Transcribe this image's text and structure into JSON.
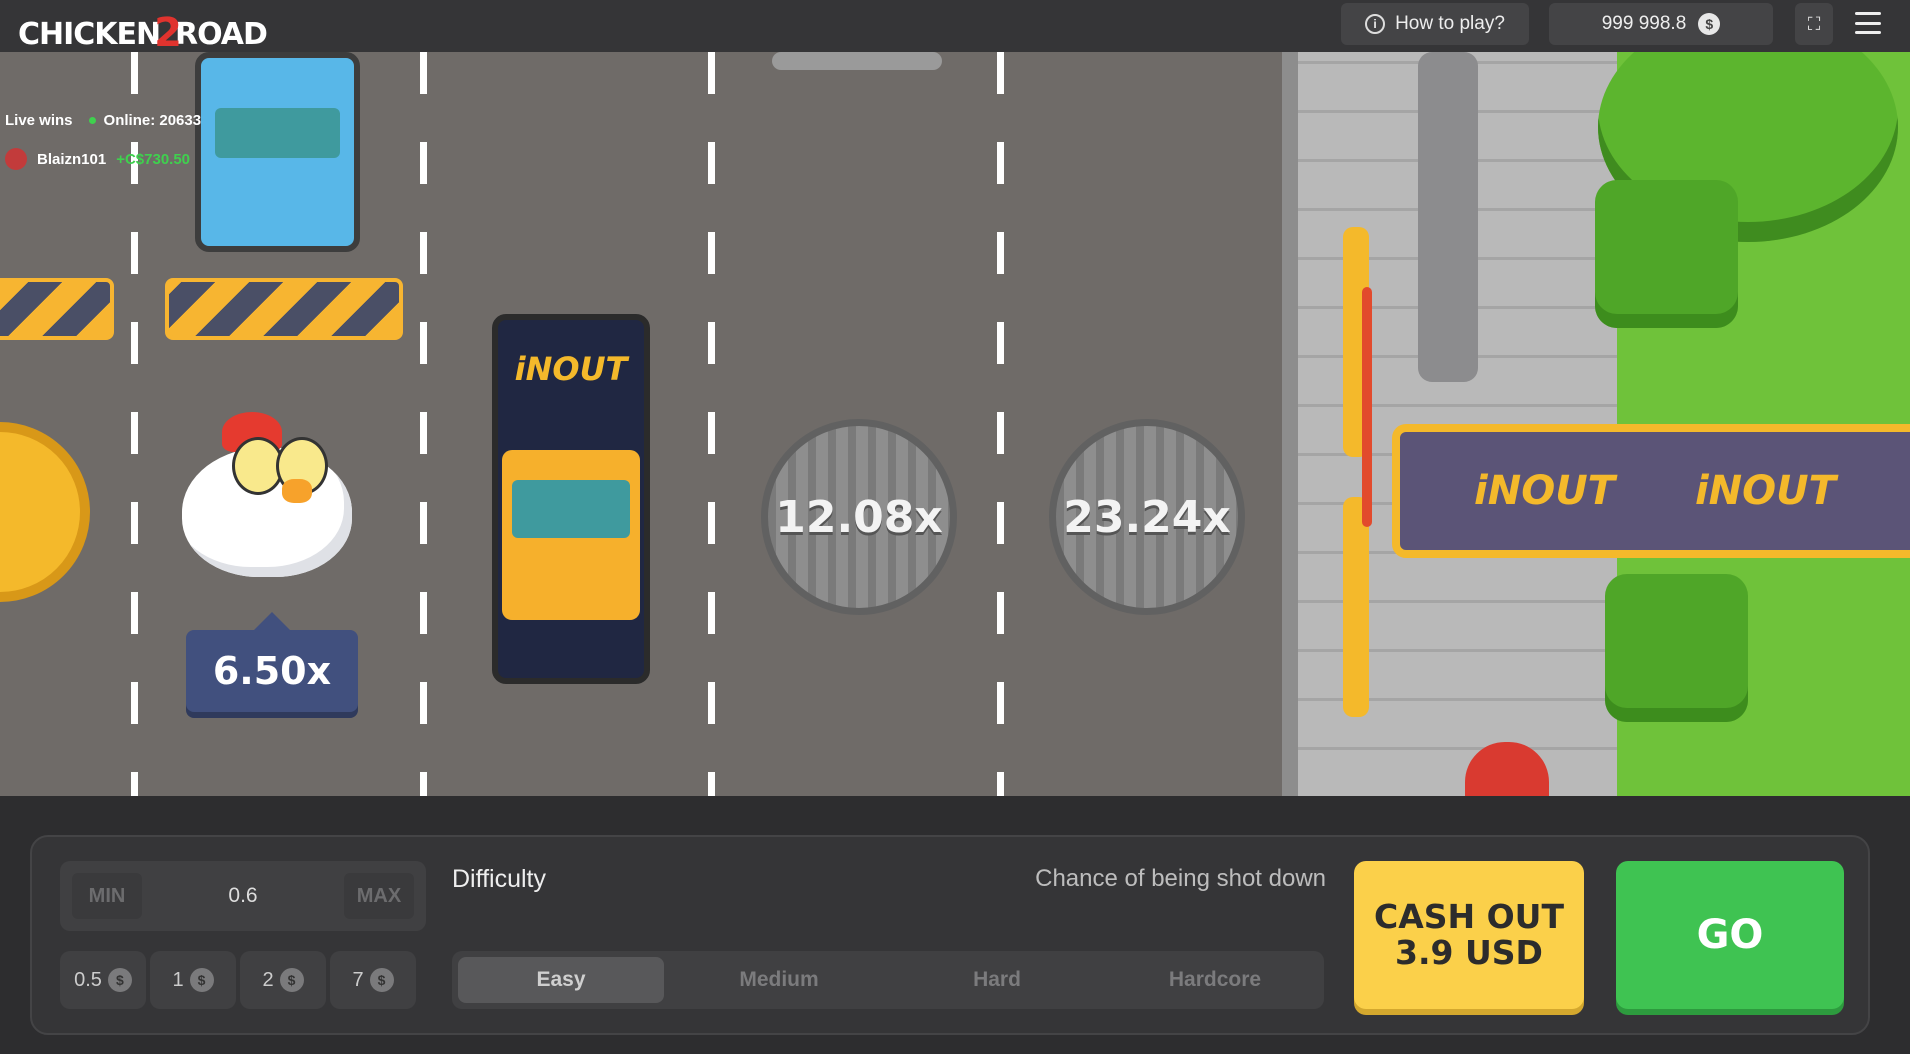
{
  "header": {
    "logo_text_a": "CHICKEN",
    "logo_text_2": "2",
    "logo_text_b": "ROAD",
    "how_to_play": "How to play?",
    "balance": "999 998.8",
    "currency_icon": "$"
  },
  "live": {
    "label": "Live wins",
    "online": "Online: 20633",
    "last_winner": {
      "name": "Blaizn101",
      "amount": "+C$730.50"
    }
  },
  "road": {
    "chicken_multiplier": "6.50x",
    "manholes": [
      "12.08x",
      "23.24x"
    ],
    "truck_brand": "iNOUT",
    "banner_brands": [
      "iNOUT",
      "iNOUT"
    ]
  },
  "controls": {
    "min": "MIN",
    "max": "MAX",
    "bet_value": "0.6",
    "chips": [
      "0.5",
      "1",
      "2",
      "7"
    ],
    "difficulty_label": "Difficulty",
    "chance_label": "Chance of being shot down",
    "difficulties": [
      "Easy",
      "Medium",
      "Hard",
      "Hardcore"
    ],
    "active_difficulty": "Easy",
    "cashout_line1": "CASH OUT",
    "cashout_line2": "3.9 USD",
    "go": "GO"
  },
  "colors": {
    "cashout": "#fbd04a",
    "go": "#3fc352",
    "win_green": "#3fd04e",
    "road": "#6f6b68"
  }
}
